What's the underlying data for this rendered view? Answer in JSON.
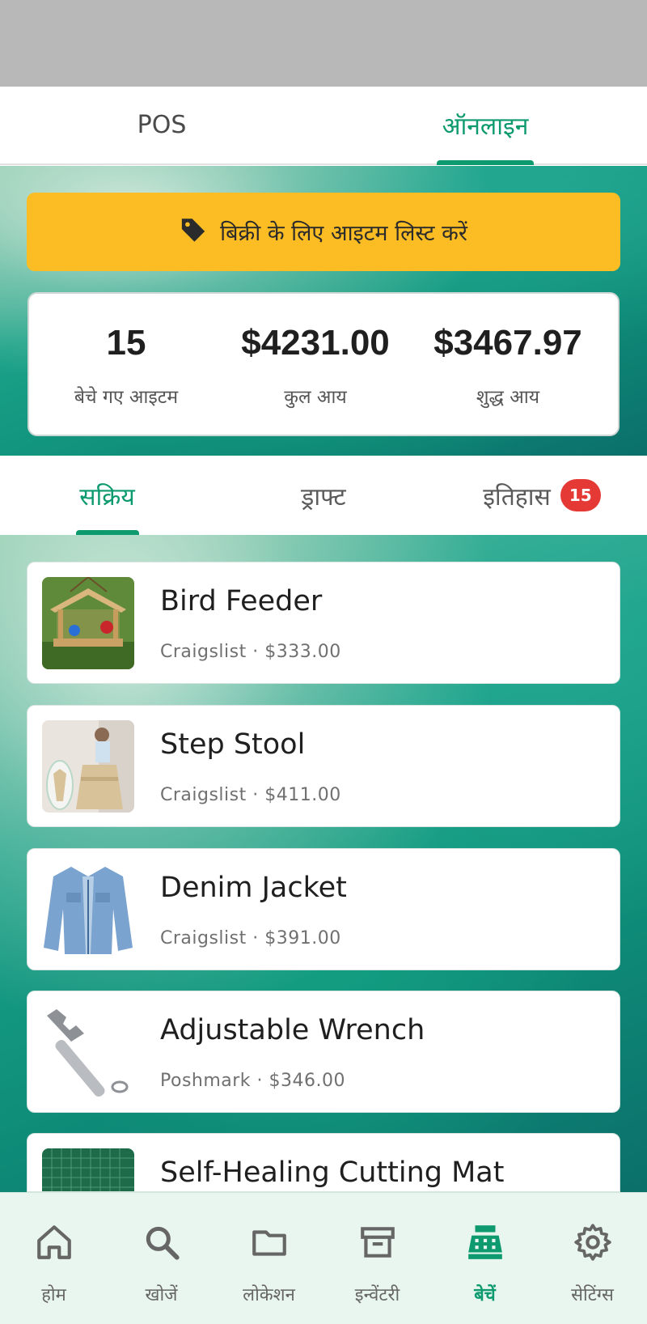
{
  "top_tabs": [
    {
      "label": "POS",
      "active": false
    },
    {
      "label": "ऑनलाइन",
      "active": true
    }
  ],
  "list_button": {
    "label": "बिक्री के लिए आइटम लिस्ट करें",
    "icon": "tag-icon"
  },
  "stats": [
    {
      "value": "15",
      "label": "बेचे गए आइटम"
    },
    {
      "value": "$4231.00",
      "label": "कुल आय"
    },
    {
      "value": "$3467.97",
      "label": "शुद्ध आय"
    }
  ],
  "sub_tabs": [
    {
      "label": "सक्रिय",
      "active": true
    },
    {
      "label": "ड्राफ्ट",
      "active": false
    },
    {
      "label": "इतिहास",
      "active": false,
      "badge": "15"
    }
  ],
  "items": [
    {
      "title": "Bird Feeder",
      "subtitle": "Craigslist · $333.00"
    },
    {
      "title": "Step Stool",
      "subtitle": "Craigslist · $411.00"
    },
    {
      "title": "Denim Jacket",
      "subtitle": "Craigslist · $391.00"
    },
    {
      "title": "Adjustable Wrench",
      "subtitle": "Poshmark · $346.00"
    },
    {
      "title": "Self-Healing Cutting Mat",
      "subtitle": ""
    }
  ],
  "bottom_nav": [
    {
      "label": "होम",
      "icon": "home-icon",
      "active": false
    },
    {
      "label": "खोजें",
      "icon": "search-icon",
      "active": false
    },
    {
      "label": "लोकेशन",
      "icon": "folder-icon",
      "active": false
    },
    {
      "label": "इन्वेंटरी",
      "icon": "archive-box-icon",
      "active": false
    },
    {
      "label": "बेचें",
      "icon": "cash-register-icon",
      "active": true
    },
    {
      "label": "सेटिंग्स",
      "icon": "gear-icon",
      "active": false
    }
  ],
  "colors": {
    "accent": "#0c9a6e",
    "button": "#fbbd23",
    "badge": "#e53935",
    "nav_background": "#e9f6ef"
  }
}
